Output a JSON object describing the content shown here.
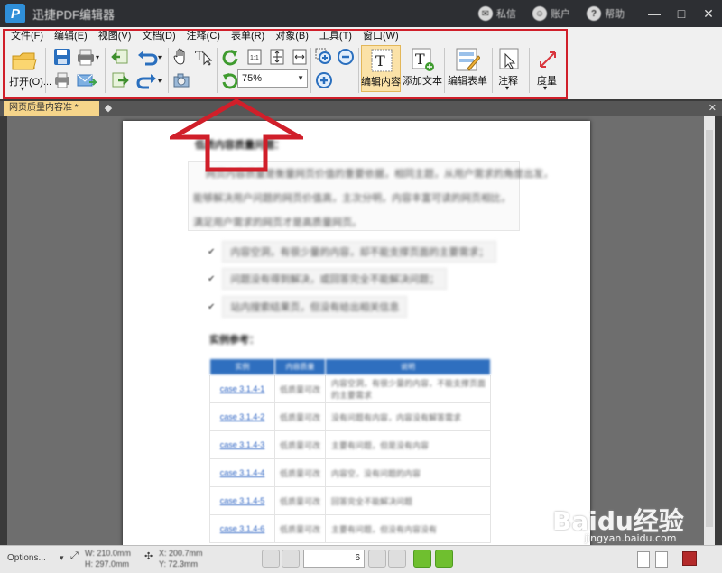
{
  "window": {
    "title": "迅捷PDF编辑器",
    "user_items": [
      "私信",
      "账户",
      "帮助"
    ],
    "controls": [
      "—",
      "□",
      "✕"
    ]
  },
  "menu": [
    "文件(F)",
    "编辑(E)",
    "视图(V)",
    "文档(D)",
    "注释(C)",
    "表单(R)",
    "对象(B)",
    "工具(T)",
    "窗口(W)"
  ],
  "toolbar": {
    "open_label": "打开(O)...",
    "zoom_value": "75%",
    "edit_content_label": "编辑内容",
    "add_text_label": "添加文本",
    "edit_form_label": "编辑表单",
    "annotate_label": "注释",
    "measure_label": "度量"
  },
  "tabs": {
    "active_tab": "网页质量内容准 *"
  },
  "document": {
    "section_title": "低质内容质量问题：",
    "paragraph_lines": [
      "网页内容质量是衡量网页价值的重要依据，相同主题，从用户需求的角度出发，",
      "能够解决用户问题的网页价值高，主次分明，内容丰富可读的网页相比，",
      "满足用户需求的网页才是高质量网页。"
    ],
    "bullets": [
      "内容空洞，有很少量的内容，却不能支撑页面的主要需求；",
      "问题没有得到解决，或回答完全不能解决问题；",
      "站内搜索结果页，但没有给出相关信息"
    ],
    "examples_title": "实例参考：",
    "table_headers": [
      "实例",
      "内容质量",
      "说明"
    ],
    "table_rows": [
      [
        "case 3.1.4-1",
        "低质量可改",
        "内容空洞，有很少量的内容，不能支撑页面的主要需求"
      ],
      [
        "case 3.1.4-2",
        "低质量可改",
        "没有问题有内容，内容没有解答需求"
      ],
      [
        "case 3.1.4-3",
        "低质量可改",
        "主要有问题，但是没有内容"
      ],
      [
        "case 3.1.4-4",
        "低质量可改",
        "内容空，没有问题的内容"
      ],
      [
        "case 3.1.4-5",
        "低质量可改",
        "回答完全不能解决问题"
      ],
      [
        "case 3.1.4-6",
        "低质量可改",
        "主要有问题，但没有内容没有"
      ]
    ]
  },
  "statusbar": {
    "options_label": "Options...",
    "width_text": "W: 210.0mm",
    "height_text": "H: 297.0mm",
    "x_text": "X: 200.7mm",
    "y_text": "Y: 72.3mm",
    "page_value": "6"
  },
  "watermark": {
    "brand": "Baidu经验",
    "url": "jingyan.baidu.com"
  }
}
